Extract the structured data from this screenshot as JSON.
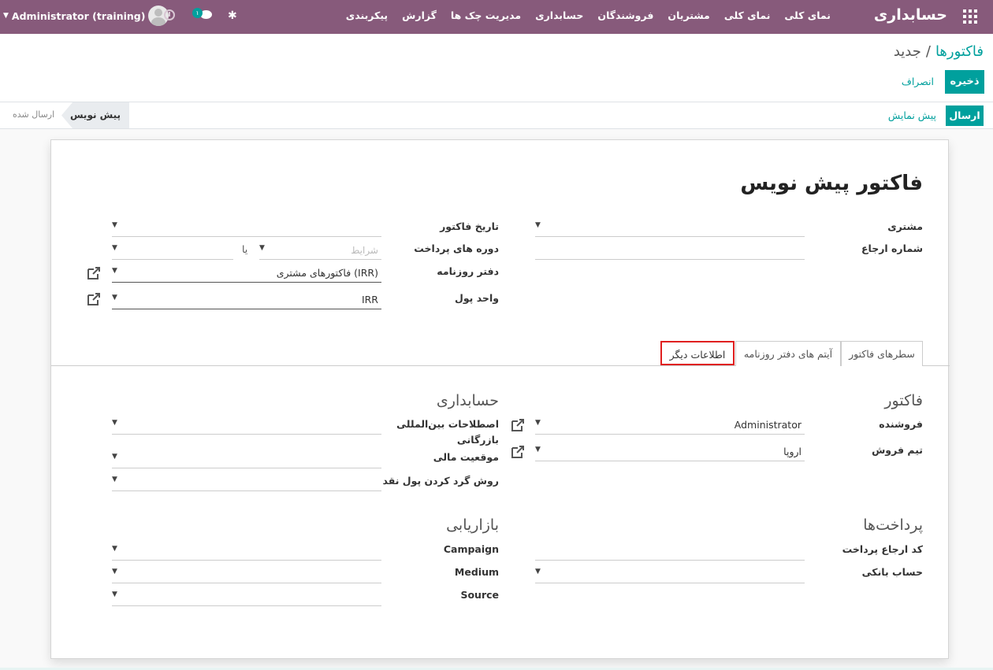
{
  "navbar": {
    "brand": "حسابداری",
    "menu": [
      "نمای کلی",
      "نمای کلی",
      "مشتریان",
      "فروشندگان",
      "حسابداری",
      "مدیریت چک ها",
      "گزارش",
      "پیکربندی"
    ],
    "user": "Administrator (training)",
    "chat_count": "۱"
  },
  "breadcrumb": {
    "parent": "فاکتورها",
    "separator": "/",
    "current": "جدید"
  },
  "buttons": {
    "save": "ذخیره",
    "discard": "انصراف",
    "send": "ارسال",
    "preview": "پیش نمایش"
  },
  "status": {
    "draft": "پیش نویس",
    "sent": "ارسال شده"
  },
  "form": {
    "title": "فاکتور پیش نویس",
    "customer_label": "مشتری",
    "reference_label": "شماره ارجاع",
    "invoice_date_label": "تاریخ فاکتور",
    "payment_terms_label": "دوره های پرداخت",
    "payment_terms_placeholder": "شرایط",
    "or_label": "یا",
    "journal_label": "دفتر روزنامه",
    "journal_value": "فاکتورهای مشتری (IRR)",
    "currency_label": "واحد پول",
    "currency_value": "IRR"
  },
  "tabs": [
    "سطرهای فاکتور",
    "آیتم های دفتر روزنامه",
    "اطلاعات دیگر"
  ],
  "other_info": {
    "invoice_section": "فاکتور",
    "salesperson_label": "فروشنده",
    "salesperson_value": "Administrator",
    "sales_team_label": "تیم فروش",
    "sales_team_value": "اروپا",
    "accounting_section": "حسابداری",
    "incoterm_label_1": "اصطلاحات بین‌المللی",
    "incoterm_label_2": "بازرگانی",
    "fiscal_position_label": "موقعیت مالی",
    "cash_rounding_label": "روش گرد کردن پول نقد",
    "payments_section": "پرداخت‌ها",
    "payment_ref_label": "کد ارجاع پرداخت",
    "bank_account_label": "حساب بانکی",
    "marketing_section": "بازاریابی",
    "campaign_label": "Campaign",
    "medium_label": "Medium",
    "source_label": "Source"
  },
  "colors": {
    "navbar": "#875a7b",
    "primary": "#00a09d",
    "highlight": "#e02020"
  }
}
